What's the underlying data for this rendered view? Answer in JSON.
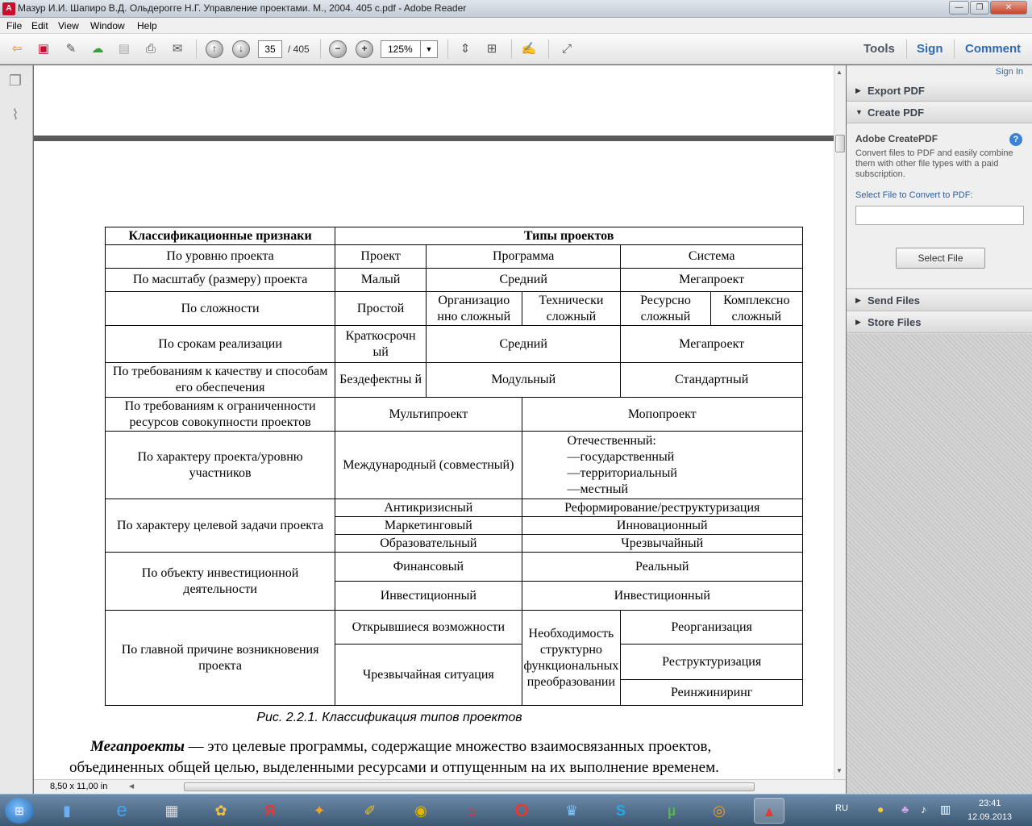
{
  "window": {
    "title": "Мазур И.И. Шапиро В.Д. Ольдерогге Н.Г. Управление проектами. М., 2004. 405 с.pdf - Adobe Reader"
  },
  "menu": [
    "File",
    "Edit",
    "View",
    "Window",
    "Help"
  ],
  "toolbar": {
    "page_current": "35",
    "page_total": "/ 405",
    "zoom": "125%",
    "tools_label": "Tools",
    "sign_label": "Sign",
    "comment_label": "Comment"
  },
  "right_panel": {
    "sign_in": "Sign In",
    "export_pdf": "Export PDF",
    "create_pdf": "Create PDF",
    "createpdf_title": "Adobe CreatePDF",
    "createpdf_desc": "Convert files to PDF and easily combine them with other file types with a paid subscription.",
    "select_label": "Select File to Convert to PDF:",
    "select_button": "Select File",
    "send_files": "Send Files",
    "store_files": "Store Files"
  },
  "document": {
    "table": {
      "h1": "Классификационные признаки",
      "h2": "Типы проектов",
      "r1": [
        "По уровню проекта",
        "Проект",
        "Программа",
        "Система"
      ],
      "r2": [
        "По масштабу (размеру) проекта",
        "Малый",
        "Средний",
        "Мегапроект"
      ],
      "r3": [
        "По сложности",
        "Простой",
        "Организацио нно сложный",
        "Технически сложный",
        "Ресурсно сложный",
        "Комплексно сложный"
      ],
      "r4": [
        "По срокам реализации",
        "Краткосрочн ый",
        "Средний",
        "Мегапроект"
      ],
      "r5": [
        "По требованиям к качеству и способам его обеспечения",
        "Бездефектны й",
        "Модульный",
        "Стандартный"
      ],
      "r6": [
        "По требованиям к ограниченности ресурсов совокупности проектов",
        "Мультипроект",
        "Мопопроект"
      ],
      "r7": [
        "По характеру проекта/уровню участников",
        "Международный (совместный)",
        "Отечественный:",
        "—государственный",
        "—территориальный",
        "—местный"
      ],
      "r8": [
        "По характеру целевой задачи проекта",
        "Антикризисный",
        "Реформирование/реструктуризация",
        "Маркетинговый",
        "Инновационный",
        "Образовательный",
        "Чрезвычайный"
      ],
      "r9": [
        "По объекту инвестиционной деятельности",
        "Финансовый",
        "Реальный",
        "Инвестиционный",
        "Инвестиционный"
      ],
      "r10": [
        "По главной причине возникновения проекта",
        "Открывшиеся возможности",
        "Необходимость структурно функциональных преобразовании",
        "Реорганизация",
        "Чрезвычайная ситуация",
        "Реструктуризация",
        "Реинжиниринг"
      ]
    },
    "caption": "Рис. 2.2.1. Классификация типов проектов",
    "para_term": "Мегапроекты",
    "para_line1": " — это целевые программы, содержащие множество взаимосвязанных проектов,",
    "para_line2": "объединенных общей целью, выделенными ресурсами и отпущенным на их выполнение временем."
  },
  "statusbar": {
    "page_size": "8,50 x 11,00 in"
  },
  "taskbar": {
    "lang": "RU",
    "time": "23:41",
    "date": "12.09.2013"
  }
}
